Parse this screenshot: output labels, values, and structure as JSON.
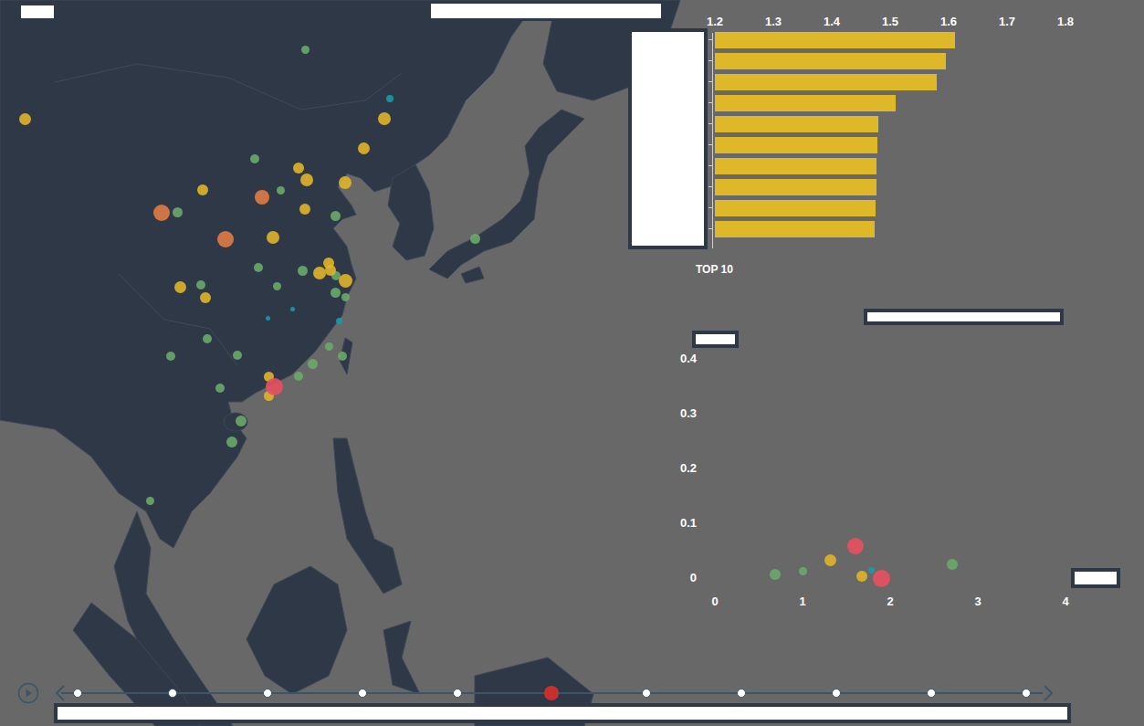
{
  "map": {
    "points": [
      {
        "lon": 117.2,
        "lat": 50.5,
        "value": 9,
        "color": "#6aaa6a"
      },
      {
        "lon": 111.0,
        "lat": 40.5,
        "value": 10,
        "color": "#6aaa6a"
      },
      {
        "lon": 114.2,
        "lat": 37.6,
        "value": 9,
        "color": "#6aaa6a"
      },
      {
        "lon": 101.6,
        "lat": 35.6,
        "value": 11,
        "color": "#6aaa6a"
      },
      {
        "lon": 120.8,
        "lat": 35.3,
        "value": 11,
        "color": "#6aaa6a"
      },
      {
        "lon": 111.4,
        "lat": 30.6,
        "value": 10,
        "color": "#6aaa6a"
      },
      {
        "lon": 116.8,
        "lat": 30.3,
        "value": 11,
        "color": "#6aaa6a"
      },
      {
        "lon": 104.4,
        "lat": 29.0,
        "value": 10,
        "color": "#6aaa6a"
      },
      {
        "lon": 113.7,
        "lat": 28.9,
        "value": 9,
        "color": "#6aaa6a"
      },
      {
        "lon": 120.8,
        "lat": 28.3,
        "value": 11,
        "color": "#6aaa6a"
      },
      {
        "lon": 122.0,
        "lat": 27.9,
        "value": 9,
        "color": "#6aaa6a"
      },
      {
        "lon": 120.9,
        "lat": 29.8,
        "value": 10,
        "color": "#6aaa6a"
      },
      {
        "lon": 105.2,
        "lat": 24.1,
        "value": 10,
        "color": "#6aaa6a"
      },
      {
        "lon": 100.8,
        "lat": 22.5,
        "value": 10,
        "color": "#6aaa6a"
      },
      {
        "lon": 108.9,
        "lat": 22.6,
        "value": 10,
        "color": "#6aaa6a"
      },
      {
        "lon": 120.0,
        "lat": 23.4,
        "value": 9,
        "color": "#6aaa6a"
      },
      {
        "lon": 121.7,
        "lat": 22.5,
        "value": 10,
        "color": "#6aaa6a"
      },
      {
        "lon": 118.1,
        "lat": 21.8,
        "value": 11,
        "color": "#6aaa6a"
      },
      {
        "lon": 116.3,
        "lat": 20.7,
        "value": 10,
        "color": "#6aaa6a"
      },
      {
        "lon": 106.8,
        "lat": 19.6,
        "value": 10,
        "color": "#6aaa6a"
      },
      {
        "lon": 109.3,
        "lat": 16.6,
        "value": 12,
        "color": "#6aaa6a"
      },
      {
        "lon": 108.2,
        "lat": 14.7,
        "value": 12,
        "color": "#6aaa6a"
      },
      {
        "lon": 98.3,
        "lat": 9.3,
        "value": 9,
        "color": "#6aaa6a"
      },
      {
        "lon": 137.8,
        "lat": 33.2,
        "value": 11,
        "color": "#6aaa6a"
      },
      {
        "lon": 83.0,
        "lat": 44.1,
        "value": 13,
        "color": "#e0b52a"
      },
      {
        "lon": 126.8,
        "lat": 44.2,
        "value": 14,
        "color": "#e0b52a"
      },
      {
        "lon": 124.3,
        "lat": 41.5,
        "value": 13,
        "color": "#e0b52a"
      },
      {
        "lon": 116.3,
        "lat": 39.7,
        "value": 12,
        "color": "#e0b52a"
      },
      {
        "lon": 117.3,
        "lat": 38.6,
        "value": 14,
        "color": "#e0b52a"
      },
      {
        "lon": 122.0,
        "lat": 38.3,
        "value": 14,
        "color": "#e0b52a"
      },
      {
        "lon": 104.7,
        "lat": 37.7,
        "value": 12,
        "color": "#e0b52a"
      },
      {
        "lon": 117.1,
        "lat": 35.9,
        "value": 12,
        "color": "#e0b52a"
      },
      {
        "lon": 113.2,
        "lat": 33.3,
        "value": 14,
        "color": "#e0b52a"
      },
      {
        "lon": 120.0,
        "lat": 31.0,
        "value": 12,
        "color": "#e0b52a"
      },
      {
        "lon": 118.9,
        "lat": 30.1,
        "value": 14,
        "color": "#e0b52a"
      },
      {
        "lon": 120.2,
        "lat": 30.3,
        "value": 12,
        "color": "#e0b52a"
      },
      {
        "lon": 122.0,
        "lat": 29.4,
        "value": 15,
        "color": "#e0b52a"
      },
      {
        "lon": 101.9,
        "lat": 28.8,
        "value": 13,
        "color": "#e0b52a"
      },
      {
        "lon": 105.0,
        "lat": 27.8,
        "value": 12,
        "color": "#e0b52a"
      },
      {
        "lon": 112.7,
        "lat": 20.6,
        "value": 11,
        "color": "#e0b52a"
      },
      {
        "lon": 112.7,
        "lat": 18.9,
        "value": 11,
        "color": "#e0b52a"
      },
      {
        "lon": 111.9,
        "lat": 37.0,
        "value": 16,
        "color": "#e07b45"
      },
      {
        "lon": 99.7,
        "lat": 35.6,
        "value": 18,
        "color": "#e07b45"
      },
      {
        "lon": 107.4,
        "lat": 33.2,
        "value": 18,
        "color": "#e07b45"
      },
      {
        "lon": 113.4,
        "lat": 19.7,
        "value": 19,
        "color": "#e85060"
      },
      {
        "lon": 127.4,
        "lat": 46.0,
        "value": 8,
        "color": "#1a9aa6"
      },
      {
        "lon": 121.3,
        "lat": 25.7,
        "value": 7,
        "color": "#1a9aa6"
      },
      {
        "lon": 115.6,
        "lat": 26.8,
        "value": 5,
        "color": "#1a9aa6"
      },
      {
        "lon": 112.6,
        "lat": 26.0,
        "value": 5,
        "color": "#1a9aa6"
      }
    ]
  },
  "bar_chart": {
    "axis_ticks": [
      "1.2",
      "1.3",
      "1.4",
      "1.5",
      "1.6",
      "1.7",
      "1.8"
    ],
    "values": [
      1.611,
      1.595,
      1.58,
      1.509,
      1.48,
      1.478,
      1.477,
      1.477,
      1.475,
      1.473
    ],
    "caption": "TOP 10"
  },
  "scatter": {
    "y_ticks": [
      "0.4",
      "0.3",
      "0.2",
      "0.1",
      "0"
    ],
    "x_ticks": [
      "0",
      "1",
      "2",
      "3",
      "4"
    ],
    "points": [
      {
        "x": 0.69,
        "y": 0.007,
        "value": 12,
        "color": "#6aaa6a"
      },
      {
        "x": 1.01,
        "y": 0.012,
        "value": 9,
        "color": "#6aaa6a"
      },
      {
        "x": 1.32,
        "y": 0.033,
        "value": 13,
        "color": "#e0b52a"
      },
      {
        "x": 1.6,
        "y": 0.058,
        "value": 18,
        "color": "#e85060"
      },
      {
        "x": 1.68,
        "y": 0.003,
        "value": 12,
        "color": "#e0b52a"
      },
      {
        "x": 1.79,
        "y": 0.015,
        "value": 7,
        "color": "#1a9aa6"
      },
      {
        "x": 1.9,
        "y": 0.0,
        "value": 19,
        "color": "#e85060"
      },
      {
        "x": 2.71,
        "y": 0.025,
        "value": 12,
        "color": "#6aaa6a"
      }
    ]
  },
  "timeline": {
    "steps": [
      {
        "selected": false
      },
      {
        "selected": false
      },
      {
        "selected": false
      },
      {
        "selected": false
      },
      {
        "selected": false
      },
      {
        "selected": true
      },
      {
        "selected": false
      },
      {
        "selected": false
      },
      {
        "selected": false
      },
      {
        "selected": false
      },
      {
        "selected": false
      }
    ]
  }
}
